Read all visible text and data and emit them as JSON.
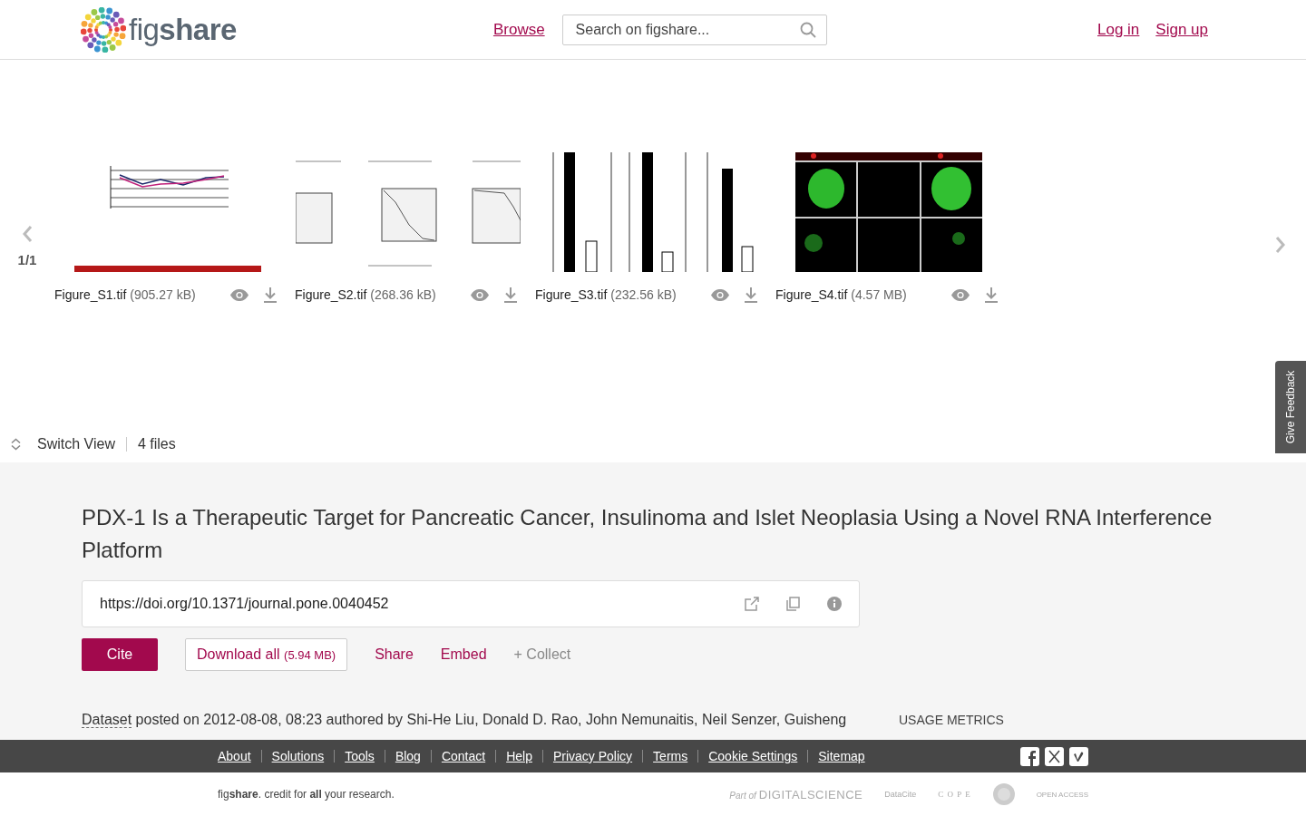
{
  "header": {
    "logo": "fig**share**",
    "nav_link": "Browse",
    "search": {
      "placeholder": "Search on figshare..."
    },
    "auth_links": [
      "Log in",
      "Sign up"
    ]
  },
  "carousel": {
    "position": "1/1",
    "files": [
      {
        "name": "Figure_S1.tif",
        "size": "(905.27 kB)",
        "kind": "picture"
      },
      {
        "name": "Figure_S2.tif",
        "size": "(268.36 kB)",
        "kind": "picture"
      },
      {
        "name": "Figure_S3.tif",
        "size": "(232.56 kB)",
        "kind": "picture"
      },
      {
        "name": "Figure_S4.tif",
        "size": "(4.57 MB)",
        "kind": "picture"
      }
    ]
  },
  "view_bar": {
    "switch_label": "Switch View",
    "file_count": "4 files"
  },
  "feedback_tab": "Give Feedback",
  "item": {
    "title": "PDX-1 Is a Therapeutic Target for Pancreatic Cancer, Insulinoma and Islet Neoplasia Using a Novel RNA Interference Platform",
    "doi": "https://doi.org/10.1371/journal.pone.0040452",
    "actions": [
      {
        "kind": "primary",
        "label": "Cite"
      },
      {
        "kind": "outlined",
        "label": "Download all",
        "extra": "(5.94 MB)"
      },
      {
        "kind": "link",
        "label": "Share"
      },
      {
        "kind": "link",
        "label": "Embed"
      },
      {
        "kind": "muted",
        "label": "+ Collect"
      }
    ],
    "type_link": "Dataset",
    "byline": " posted on 2012-08-08, 08:23 authored by Shi-He Liu, Donald D. Rao, John Nemunaitis, Neil Senzer, Guisheng",
    "metrics_heading": "USAGE METRICS"
  },
  "footer": {
    "links": [
      "About",
      "Solutions",
      "Tools",
      "Blog",
      "Contact",
      "Help",
      "Privacy Policy",
      "Terms",
      "Cookie Settings",
      "Sitemap"
    ],
    "tagline": "fig**share**. credit for **all** your research.",
    "partners": {
      "part_of": "Part of",
      "digital_science": "DIGITALSCIENCE",
      "datacite": "DataCite",
      "cope": "C O P E",
      "open_access": "OPEN ACCESS"
    }
  }
}
